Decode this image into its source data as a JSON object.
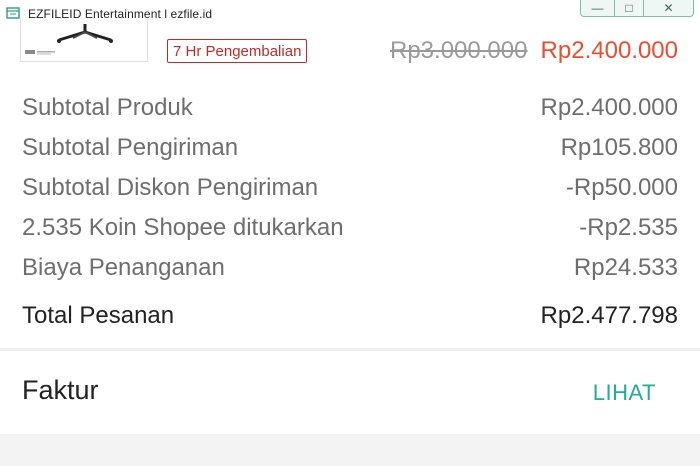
{
  "window": {
    "title": "EZFILEID Entertainment l ezfile.id",
    "min_glyph": "—",
    "max_glyph": "□",
    "close_glyph": "✕"
  },
  "product": {
    "return_badge": "7 Hr Pengembalian",
    "original_price": "Rp3.000.000",
    "discounted_price": "Rp2.400.000"
  },
  "summary": {
    "rows": [
      {
        "label": "Subtotal Produk",
        "value": "Rp2.400.000"
      },
      {
        "label": "Subtotal Pengiriman",
        "value": "Rp105.800"
      },
      {
        "label": "Subtotal Diskon Pengiriman",
        "value": "-Rp50.000"
      },
      {
        "label": "2.535 Koin Shopee ditukarkan",
        "value": "-Rp2.535"
      },
      {
        "label": "Biaya Penanganan",
        "value": "Rp24.533"
      }
    ],
    "total_label": "Total Pesanan",
    "total_value": "Rp2.477.798"
  },
  "invoice": {
    "label": "Faktur",
    "link": "LIHAT"
  },
  "colors": {
    "accent_orange": "#ee4d2d",
    "accent_teal": "#26aa99",
    "badge_red": "#c62828"
  }
}
